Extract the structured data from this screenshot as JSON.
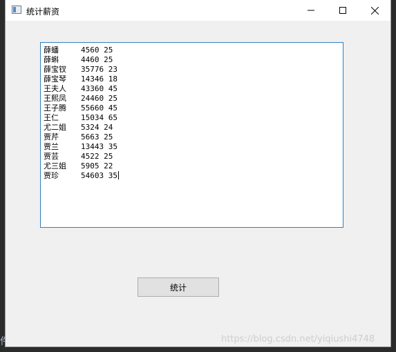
{
  "window": {
    "title": "统计薪资",
    "icon": "app-window-icon"
  },
  "controls": {
    "minimize_icon": "minimize-icon",
    "maximize_icon": "maximize-icon",
    "close_icon": "close-icon"
  },
  "editor": {
    "rows": [
      {
        "name": "薛蟠",
        "salary": "4560",
        "age": "25"
      },
      {
        "name": "薛蝌",
        "salary": "4460",
        "age": "25"
      },
      {
        "name": "薛宝钗",
        "salary": "35776",
        "age": "23"
      },
      {
        "name": "薛宝琴",
        "salary": "14346",
        "age": "18"
      },
      {
        "name": "王夫人",
        "salary": "43360",
        "age": "45"
      },
      {
        "name": "王熙凤",
        "salary": "24460",
        "age": "25"
      },
      {
        "name": "王子腾",
        "salary": "55660",
        "age": "45"
      },
      {
        "name": "王仁",
        "salary": "15034",
        "age": "65"
      },
      {
        "name": "尤二姐",
        "salary": "5324",
        "age": "24"
      },
      {
        "name": "贾芹",
        "salary": "5663",
        "age": "25"
      },
      {
        "name": "贾兰",
        "salary": "13443",
        "age": "35"
      },
      {
        "name": "贾芸",
        "salary": "4522",
        "age": "25"
      },
      {
        "name": "尤三姐",
        "salary": "5905",
        "age": "22"
      },
      {
        "name": "贾珍",
        "salary": "54603",
        "age": "35"
      }
    ]
  },
  "button": {
    "label": "统计"
  },
  "background": {
    "bottom_text": "件.py",
    "watermark": "https://blog.csdn.net/yiqiushi4748"
  },
  "colors": {
    "focus_border": "#2f7fbd",
    "window_bg": "#f0f0f0",
    "button_bg": "#e1e1e1"
  }
}
